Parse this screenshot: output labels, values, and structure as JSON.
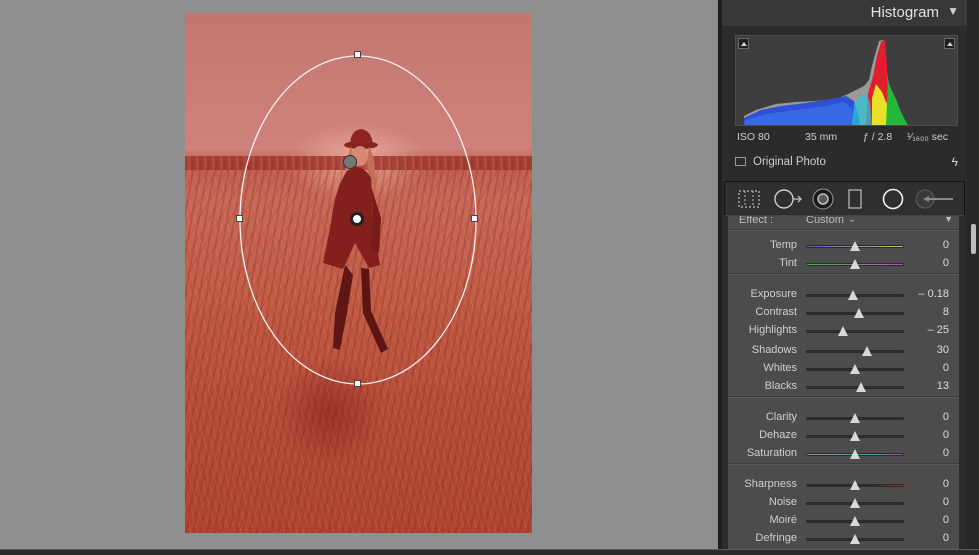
{
  "panel": {
    "histogram_title": "Histogram",
    "collapse_arrow": "▼",
    "meta": {
      "iso": "ISO 80",
      "focal": "35 mm",
      "aperture": "ƒ / 2.8",
      "shutter": "¹⁄₁₆₀₀ sec"
    },
    "original_photo_label": "Original Photo",
    "effect_label": "Effect :",
    "effect_value": "Custom",
    "sections": [
      [
        {
          "label": "Temp",
          "value": "0",
          "level": 0.5,
          "track": "temp"
        },
        {
          "label": "Tint",
          "value": "0",
          "level": 0.5,
          "track": "tint"
        }
      ],
      [
        {
          "label": "Exposure",
          "value": "– 0.18",
          "level": 0.48
        },
        {
          "label": "Contrast",
          "value": "8",
          "level": 0.54
        },
        {
          "label": "Highlights",
          "value": "– 25",
          "level": 0.38
        },
        {
          "label": "Shadows",
          "value": "30",
          "level": 0.63
        },
        {
          "label": "Whites",
          "value": "0",
          "level": 0.5
        },
        {
          "label": "Blacks",
          "value": "13",
          "level": 0.56
        }
      ],
      [
        {
          "label": "Clarity",
          "value": "0",
          "level": 0.5
        },
        {
          "label": "Dehaze",
          "value": "0",
          "level": 0.5
        },
        {
          "label": "Saturation",
          "value": "0",
          "level": 0.5,
          "track": "saturation"
        }
      ],
      [
        {
          "label": "Sharpness",
          "value": "0",
          "level": 0.5,
          "track": "sharpness"
        },
        {
          "label": "Noise",
          "value": "0",
          "level": 0.5
        },
        {
          "label": "Moiré",
          "value": "0",
          "level": 0.5
        },
        {
          "label": "Defringe",
          "value": "0",
          "level": 0.5
        }
      ]
    ]
  },
  "tools": [
    "crop-overlay-icon",
    "spot-removal-icon",
    "red-eye-icon",
    "graduated-filter-icon",
    "radial-filter-icon",
    "adjustment-brush-icon"
  ],
  "colors": {
    "panel_bg": "#2b2b2b",
    "section_bg": "#4c4c4c",
    "mask_overlay": "#dc3228"
  }
}
